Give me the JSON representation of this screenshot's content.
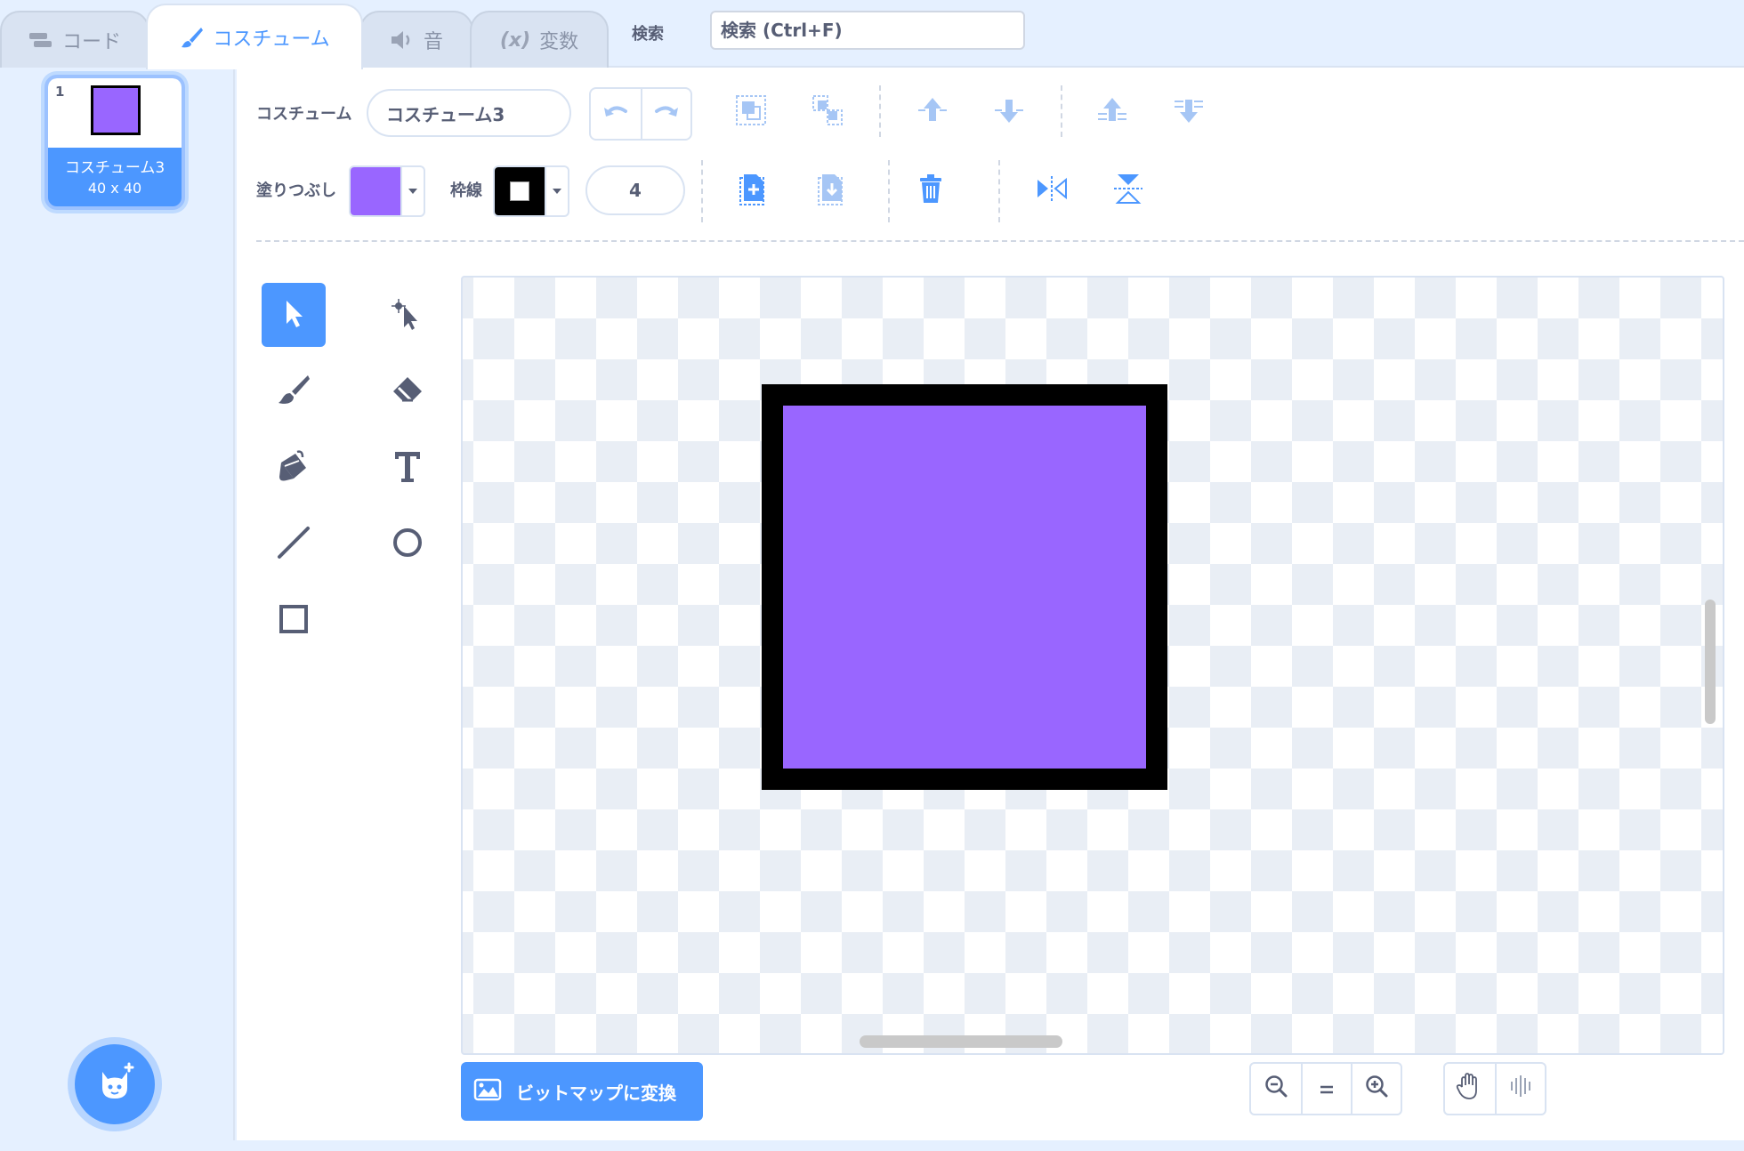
{
  "tabs": [
    {
      "label": "コード",
      "icon": "code-icon"
    },
    {
      "label": "コスチューム",
      "icon": "brush-icon",
      "active": true
    },
    {
      "label": "音",
      "icon": "speaker-icon"
    },
    {
      "label": "変数",
      "icon": "variable-icon",
      "prefix": "(x)"
    }
  ],
  "search": {
    "label": "検索",
    "placeholder": "検索 (Ctrl+F)"
  },
  "costume_list": {
    "items": [
      {
        "index": "1",
        "name": "コスチューム3",
        "size": "40 x 40",
        "fill_color": "#9966ff",
        "selected": true
      }
    ]
  },
  "toolbar": {
    "costume_label": "コスチューム",
    "costume_name": "コスチューム3",
    "fill_label": "塗りつぶし",
    "fill_color": "#9966ff",
    "outline_label": "枠線",
    "outline_color": "#000000",
    "outline_width": "4"
  },
  "tools": [
    "select",
    "reshape",
    "brush",
    "eraser",
    "fill",
    "text",
    "line",
    "circle",
    "rectangle"
  ],
  "active_tool": "select",
  "convert_button": {
    "label": "ビットマップに変換"
  },
  "colors": {
    "accent": "#4c97ff",
    "icon": "#575e75",
    "background": "#e5f0ff"
  }
}
